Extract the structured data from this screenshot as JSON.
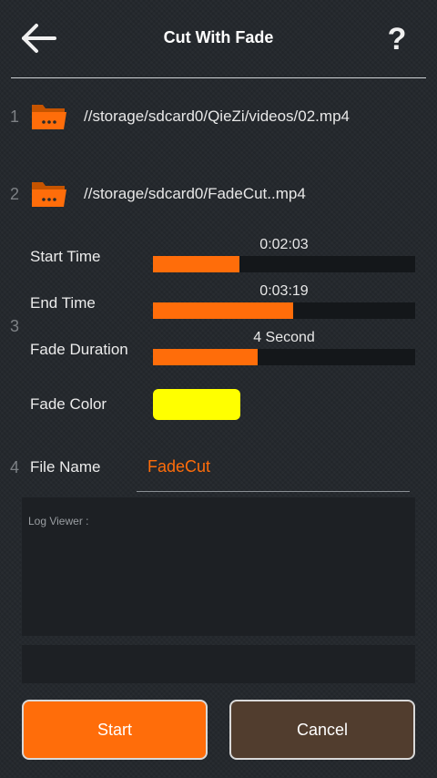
{
  "header": {
    "title": "Cut With Fade",
    "help_label": "?"
  },
  "steps": {
    "one": "1",
    "two": "2",
    "three": "3",
    "four": "4"
  },
  "input_file": {
    "path": "//storage/sdcard0/QieZi/videos/02.mp4",
    "icon": "folder-icon"
  },
  "output_file": {
    "path": "//storage/sdcard0/FadeCut..mp4",
    "icon": "folder-icon"
  },
  "sliders": {
    "start_time": {
      "label": "Start Time",
      "value": "0:02:03",
      "fraction": 0.33
    },
    "end_time": {
      "label": "End Time",
      "value": "0:03:19",
      "fraction": 0.535
    },
    "fade_duration": {
      "label": "Fade Duration",
      "value": "4 Second",
      "fraction": 0.4
    }
  },
  "fade_color": {
    "label": "Fade Color",
    "color": "#ffff00"
  },
  "file_name": {
    "label": "File Name",
    "value": "FadeCut"
  },
  "log": {
    "label": "Log Viewer :"
  },
  "buttons": {
    "start": "Start",
    "cancel": "Cancel"
  },
  "colors": {
    "accent": "#ff6d0a",
    "cancel_bg": "#513d2e",
    "background": "#23272c"
  }
}
